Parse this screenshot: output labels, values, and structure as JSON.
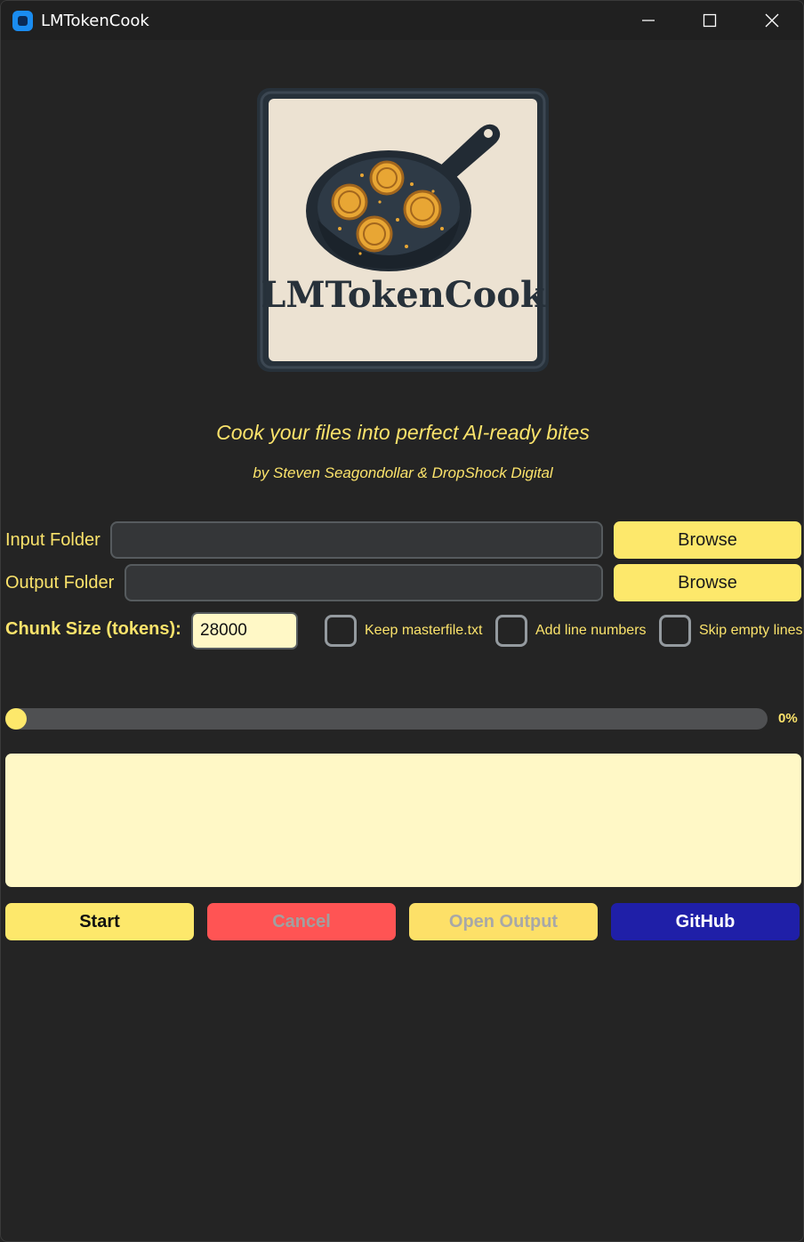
{
  "window": {
    "title": "LMTokenCook",
    "icon": "app-icon"
  },
  "logo": {
    "text": "LMTokenCook",
    "icon": "frying-pan-coins-logo"
  },
  "tagline": "Cook your files into perfect AI-ready bites",
  "byline": "by Steven Seagondollar & DropShock Digital",
  "input_folder": {
    "label": "Input Folder",
    "value": "",
    "browse_label": "Browse"
  },
  "output_folder": {
    "label": "Output Folder",
    "value": "",
    "browse_label": "Browse"
  },
  "options": {
    "chunk_label": "Chunk Size (tokens):",
    "chunk_value": "28000",
    "keep_masterfile": {
      "label": "Keep masterfile.txt",
      "checked": false
    },
    "add_line_numbers": {
      "label": "Add line numbers",
      "checked": false
    },
    "skip_empty_lines": {
      "label": "Skip empty lines",
      "checked": false
    }
  },
  "progress": {
    "value": 0,
    "text": "0%"
  },
  "log": "",
  "actions": {
    "start": "Start",
    "cancel": "Cancel",
    "open_output": "Open Output",
    "github": "GitHub"
  },
  "colors": {
    "accent": "#fde86b",
    "background": "#242424",
    "cancel": "#ff5454",
    "github": "#1f1fa8",
    "log_bg": "#fff8c6"
  }
}
